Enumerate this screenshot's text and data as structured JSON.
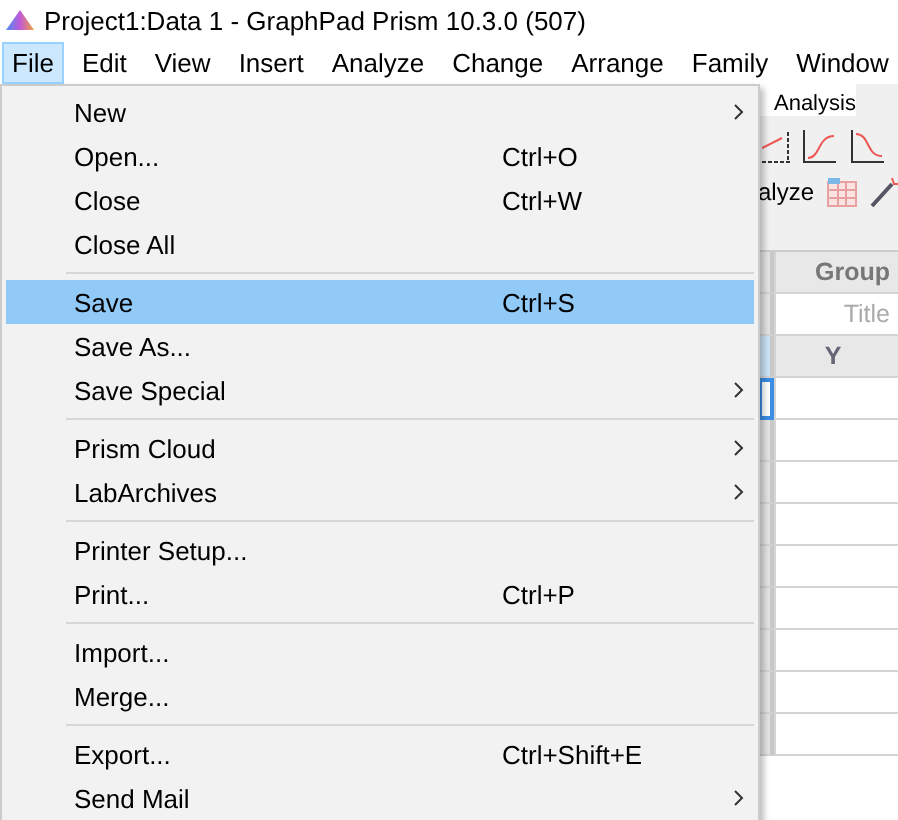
{
  "window": {
    "title": "Project1:Data 1 - GraphPad Prism 10.3.0 (507)"
  },
  "menubar": [
    {
      "label": "File",
      "selected": true
    },
    {
      "label": "Edit",
      "selected": false
    },
    {
      "label": "View",
      "selected": false
    },
    {
      "label": "Insert",
      "selected": false
    },
    {
      "label": "Analyze",
      "selected": false
    },
    {
      "label": "Change",
      "selected": false
    },
    {
      "label": "Arrange",
      "selected": false
    },
    {
      "label": "Family",
      "selected": false
    },
    {
      "label": "Window",
      "selected": false
    }
  ],
  "file_menu": {
    "groups": [
      [
        {
          "label": "New",
          "submenu": true,
          "selected": false
        },
        {
          "label": "Open...",
          "shortcut": "Ctrl+O",
          "submenu": false,
          "selected": false
        },
        {
          "label": "Close",
          "shortcut": "Ctrl+W",
          "submenu": false,
          "selected": false
        },
        {
          "label": "Close All",
          "submenu": false,
          "selected": false
        }
      ],
      [
        {
          "label": "Save",
          "shortcut": "Ctrl+S",
          "submenu": false,
          "selected": true
        },
        {
          "label": "Save As...",
          "submenu": false,
          "selected": false
        },
        {
          "label": "Save Special",
          "submenu": true,
          "selected": false
        }
      ],
      [
        {
          "label": "Prism Cloud",
          "submenu": true,
          "selected": false
        },
        {
          "label": "LabArchives",
          "submenu": true,
          "selected": false
        }
      ],
      [
        {
          "label": "Printer Setup...",
          "submenu": false,
          "selected": false
        },
        {
          "label": "Print...",
          "shortcut": "Ctrl+P",
          "submenu": false,
          "selected": false
        }
      ],
      [
        {
          "label": "Import...",
          "submenu": false,
          "selected": false
        },
        {
          "label": "Merge...",
          "submenu": false,
          "selected": false
        }
      ],
      [
        {
          "label": "Export...",
          "shortcut": "Ctrl+Shift+E",
          "submenu": false,
          "selected": false
        },
        {
          "label": "Send Mail",
          "submenu": true,
          "selected": false
        }
      ]
    ]
  },
  "toolbar": {
    "section_label": "Analysis",
    "analyze_label": "alyze"
  },
  "sheet": {
    "group_header": "Group",
    "title_placeholder": "Title",
    "column_header": "Y"
  }
}
